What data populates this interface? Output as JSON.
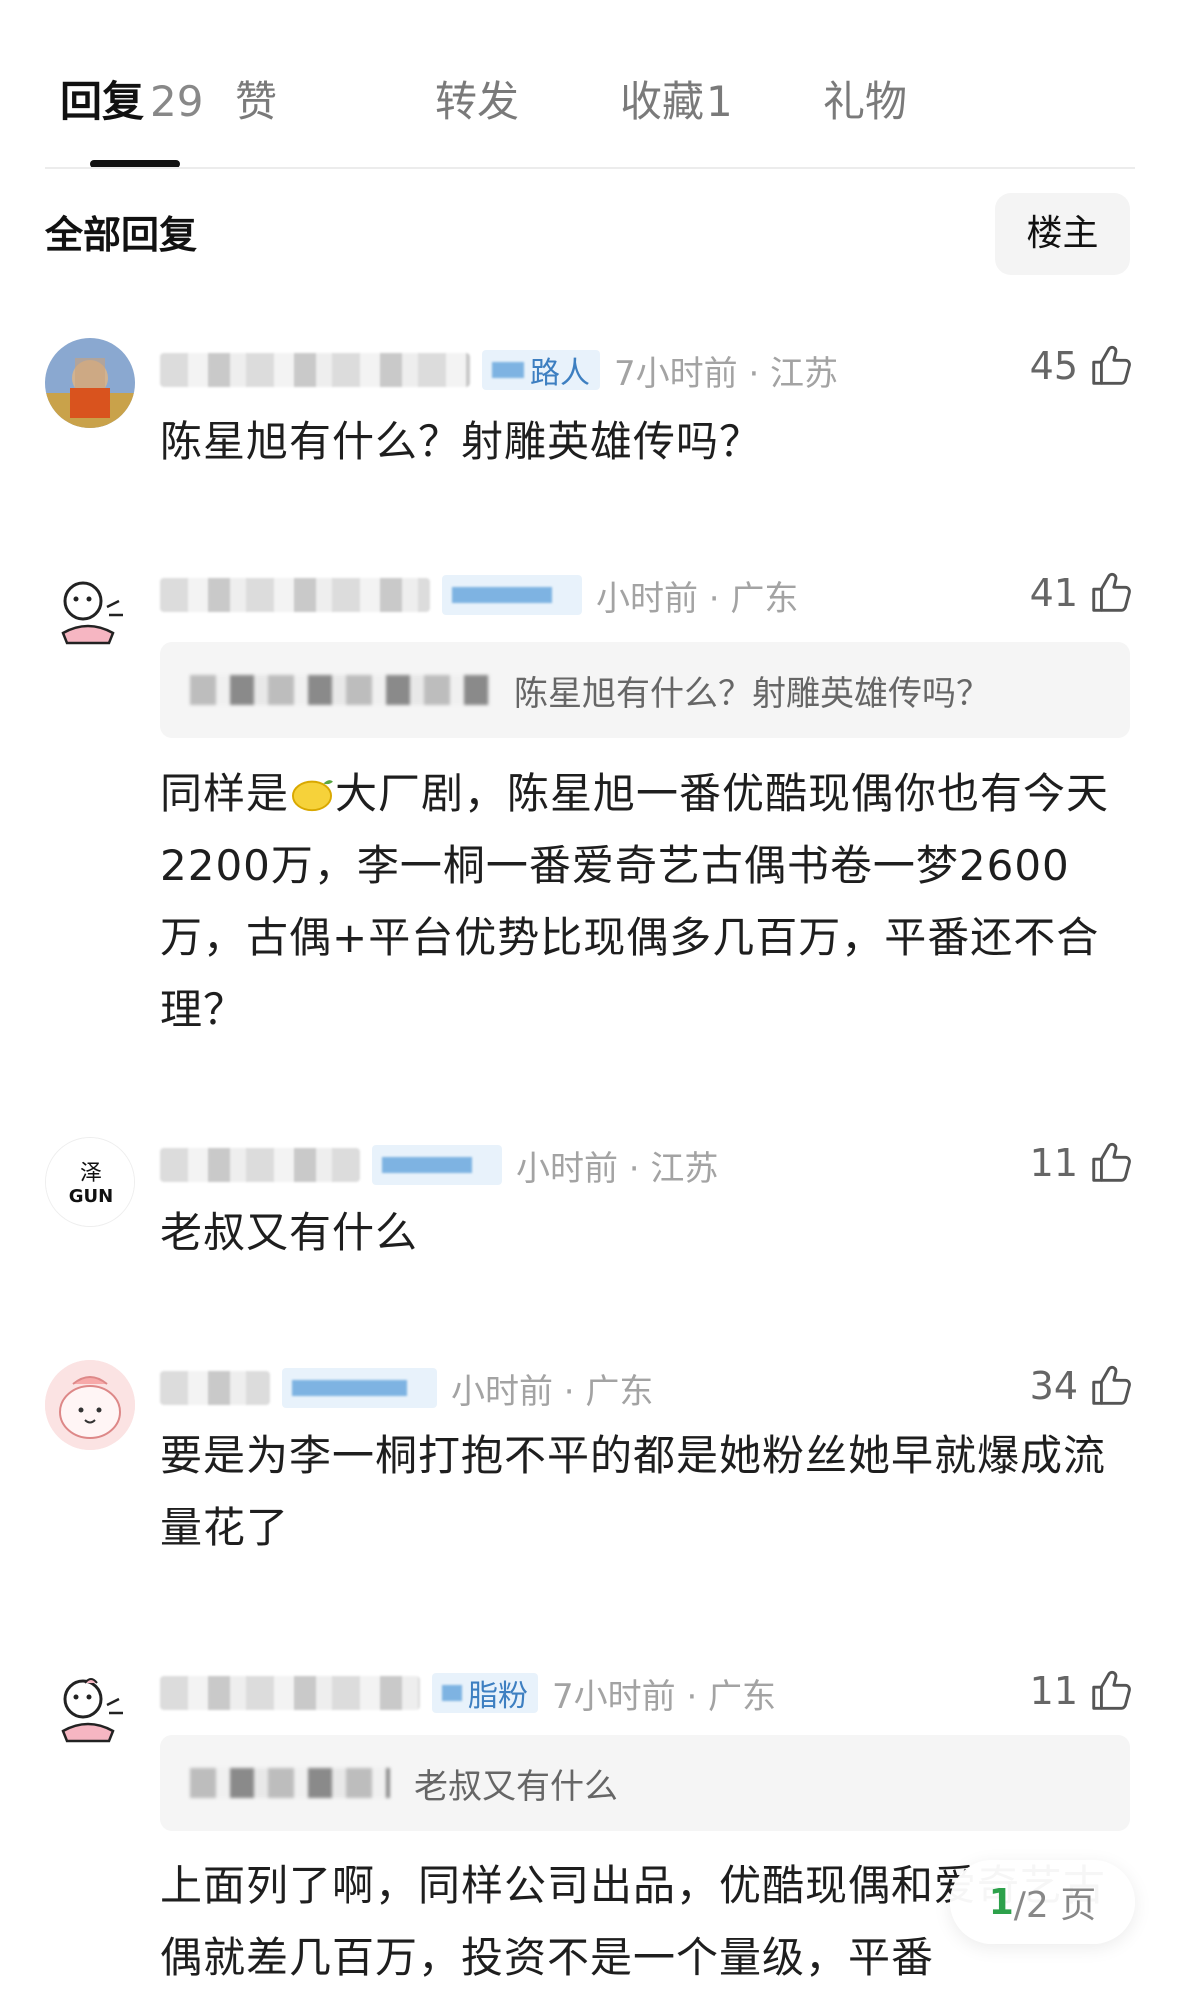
{
  "tabs": [
    {
      "label": "回复",
      "count": "29",
      "active": true
    },
    {
      "label": "赞",
      "count": "",
      "active": false
    },
    {
      "label": "转发",
      "count": "",
      "active": false
    },
    {
      "label": "收藏",
      "count": "1",
      "active": false
    },
    {
      "label": "礼物",
      "count": "",
      "active": false
    }
  ],
  "filter": {
    "label": "全部回复",
    "owner_button": "楼主"
  },
  "comments": [
    {
      "badge": "路人",
      "time": "7小时前 · 江苏",
      "likes": "45",
      "text": "陈星旭有什么？射雕英雄传吗？"
    },
    {
      "badge": "",
      "time": "小时前 · 广东",
      "likes": "41",
      "quote": "陈星旭有什么？射雕英雄传吗？",
      "text_parts": [
        "同样是",
        "大厂剧，陈星旭一番优酷现偶你也有今天2200万，李一桐一番爱奇艺古偶书卷一梦2600万，古偶+平台优势比现偶多几百万，平番还不合理？"
      ]
    },
    {
      "badge": "",
      "time": "小时前 · 江苏",
      "likes": "11",
      "text": "老叔又有什么"
    },
    {
      "badge": "",
      "time": "小时前 · 广东",
      "likes": "34",
      "text": "要是为李一桐打抱不平的都是她粉丝她早就爆成流量花了"
    },
    {
      "badge": "脂粉",
      "time": "7小时前 · 广东",
      "likes": "11",
      "quote": "老叔又有什么",
      "text": "上面列了啊，同样公司出品，优酷现偶和爱奇艺古偶就差几百万，投资不是一个量级，平番"
    }
  ],
  "pager": {
    "current": "1",
    "total": "/2 页"
  },
  "colors": {
    "accent": "#111111",
    "badge_bg": "#e8f2fb",
    "badge_text": "#3d7fc1",
    "pager_current": "#2da14b"
  },
  "icons": {
    "like": "thumbs-up-icon",
    "lemon": "lemon-emoji-icon"
  }
}
